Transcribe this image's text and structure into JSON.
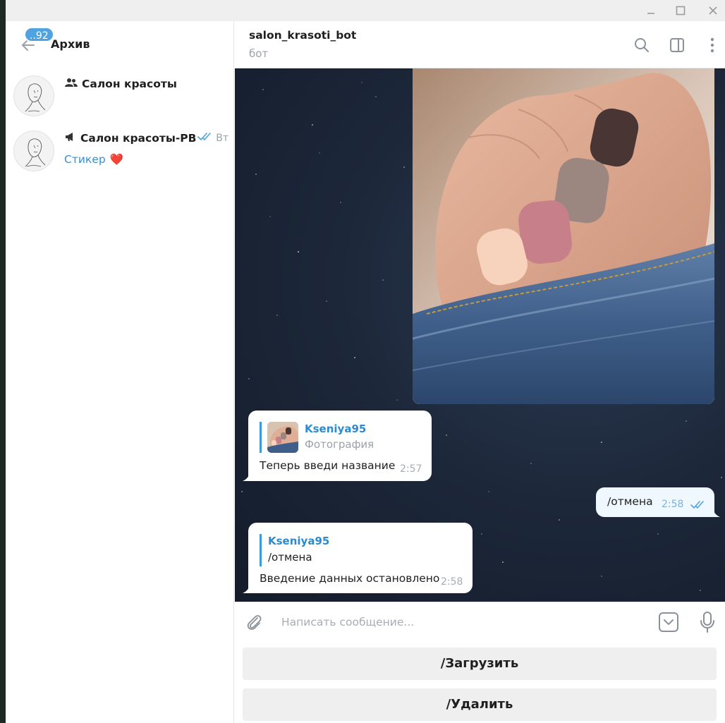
{
  "window": {
    "controls": [
      "minimize-icon",
      "maximize-icon",
      "close-icon"
    ]
  },
  "sidebar": {
    "unread_badge": "..92",
    "title": "Архив",
    "chats": [
      {
        "icon": "group-icon",
        "name": "Салон красоты",
        "time": "",
        "preview": ""
      },
      {
        "icon": "channel-icon",
        "name": "Салон красоты-РВ",
        "time": "Вт",
        "preview": "Стикер",
        "preview_emoji": "❤️"
      }
    ]
  },
  "header": {
    "title": "salon_krasoti_bot",
    "subtitle": "бот",
    "icons": [
      "search-icon",
      "sidebar-toggle-icon",
      "more-icon"
    ]
  },
  "messages": [
    {
      "type": "photo",
      "direction": "in",
      "description_icon": "photo"
    },
    {
      "direction": "in",
      "reply_author": "Kseniya95",
      "reply_text": "Фотография",
      "text": "Теперь введи название",
      "time": "2:57"
    },
    {
      "direction": "out",
      "text": "/отмена",
      "time": "2:58",
      "status": "read"
    },
    {
      "direction": "in",
      "reply_author": "Kseniya95",
      "reply_text": "/отмена",
      "text": "Введение данных остановлено",
      "time": "2:58"
    }
  ],
  "composer": {
    "placeholder": "Написать сообщение...",
    "value": ""
  },
  "bot_keyboard": [
    {
      "label": "/Загрузить"
    },
    {
      "label": "/Удалить"
    }
  ],
  "colors": {
    "accent": "#3a9bd9",
    "badge": "#4fa3e0",
    "outgoing_bubble": "#eff8ff",
    "read_checks": "#4fa3e0"
  }
}
